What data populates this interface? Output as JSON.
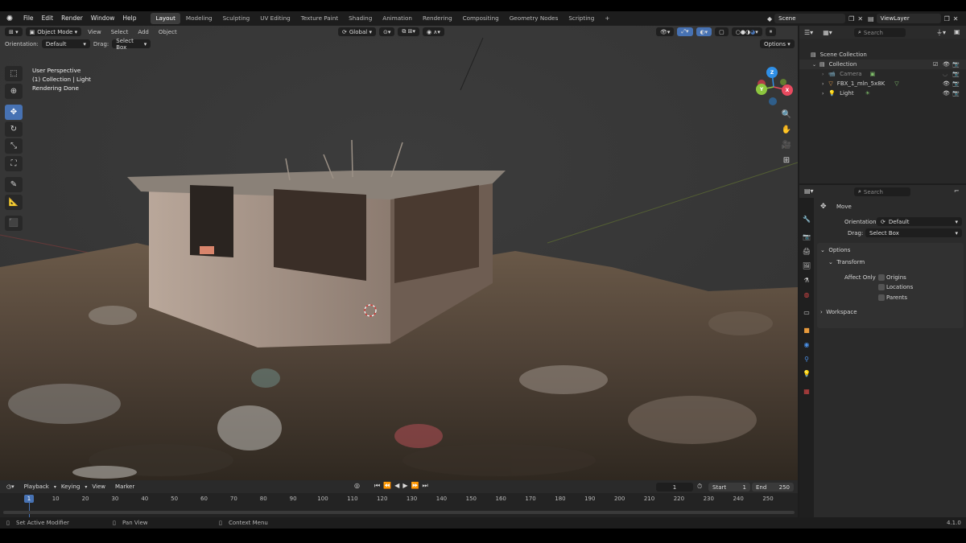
{
  "menu": {
    "items": [
      "File",
      "Edit",
      "Render",
      "Window",
      "Help"
    ]
  },
  "workspaces": [
    "Layout",
    "Modeling",
    "Sculpting",
    "UV Editing",
    "Texture Paint",
    "Shading",
    "Animation",
    "Rendering",
    "Compositing",
    "Geometry Nodes",
    "Scripting"
  ],
  "active_workspace": "Layout",
  "scene": {
    "name": "Scene",
    "view_layer": "ViewLayer"
  },
  "viewport_header": {
    "mode": "Object Mode",
    "menus": [
      "View",
      "Select",
      "Add",
      "Object"
    ],
    "transform_orientation": "Global",
    "orientation_label": "Orientation:",
    "orientation_value": "Default",
    "drag_label": "Drag:",
    "drag_value": "Select Box",
    "options": "Options"
  },
  "viewport_overlay": {
    "line1": "User Perspective",
    "line2": "(1) Collection | Light",
    "line3": "Rendering Done"
  },
  "gizmo": {
    "x": "X",
    "y": "Y",
    "z": "Z"
  },
  "timeline": {
    "menus": [
      "Playback",
      "Keying",
      "View",
      "Marker"
    ],
    "current_frame": "1",
    "start_label": "Start",
    "start": "1",
    "end_label": "End",
    "end": "250",
    "ticks": [
      "1",
      "10",
      "20",
      "30",
      "40",
      "50",
      "60",
      "70",
      "80",
      "90",
      "100",
      "110",
      "120",
      "130",
      "140",
      "150",
      "160",
      "170",
      "180",
      "190",
      "200",
      "210",
      "220",
      "230",
      "240",
      "250"
    ]
  },
  "outliner": {
    "search_placeholder": "Search",
    "items": [
      {
        "label": "Scene Collection"
      },
      {
        "label": "Collection"
      },
      {
        "label": "Camera"
      },
      {
        "label": "FBX_1_mln_5x8K"
      },
      {
        "label": "Light"
      }
    ]
  },
  "properties": {
    "search_placeholder": "Search",
    "tool_name": "Move",
    "orientation_label": "Orientation",
    "orientation_value": "Default",
    "drag_label": "Drag:",
    "drag_value": "Select Box",
    "options_panel": "Options",
    "transform_panel": "Transform",
    "affect_only_label": "Affect Only",
    "checkboxes": [
      "Origins",
      "Locations",
      "Parents"
    ],
    "workspace_panel": "Workspace"
  },
  "status_bar": {
    "left": "Set Active Modifier",
    "middle": "Pan View",
    "right": "Context Menu",
    "version": "4.1.0"
  },
  "colors": {
    "accent": "#4772b3",
    "x_axis": "#e84a5f",
    "y_axis": "#8dc63f",
    "z_axis": "#2f8fe6"
  }
}
